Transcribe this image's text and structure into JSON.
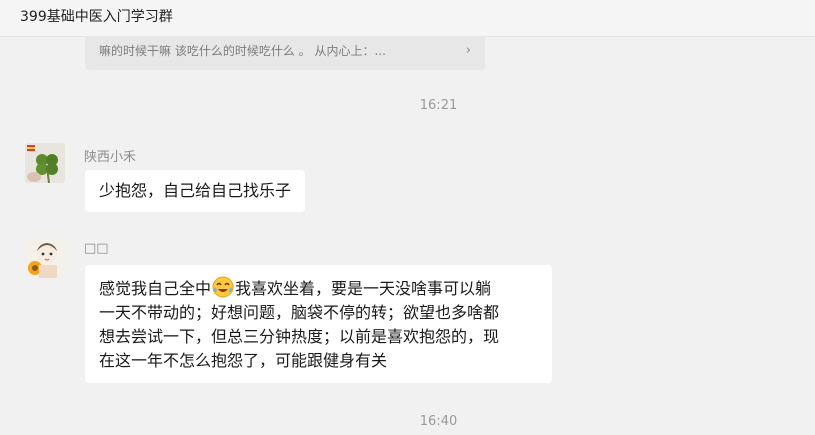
{
  "window": {
    "title": "399基础中医入门学习群"
  },
  "quoted_message": {
    "text": "嘛的时候干嘛 该吃什么的时候吃什么 。 从内心上：...",
    "chevron": "›"
  },
  "timestamps": [
    "16:21",
    "16:40"
  ],
  "messages": [
    {
      "sender": "陕西小禾",
      "avatar_icon": "clover-plant-avatar-icon",
      "lines": [
        "少抱怨，自己给自己找乐子"
      ]
    },
    {
      "sender": "□□",
      "avatar_icon": "cartoon-girl-avatar-icon",
      "lines": [
        {
          "before": "感觉我自己全中",
          "emoji": "laughing-tears-emoji-icon",
          "after": "我喜欢坐着，要是一天没啥事可以躺"
        },
        "一天不带动的；好想问题，脑袋不停的转；欲望也多啥都",
        "想去尝试一下，但总三分钟热度；以前是喜欢抱怨的，现",
        "在这一年不怎么抱怨了，可能跟健身有关"
      ]
    }
  ],
  "colors": {
    "background": "#f1f1f1",
    "bubble": "#ffffff",
    "quote_bg": "#e7e7e7"
  }
}
